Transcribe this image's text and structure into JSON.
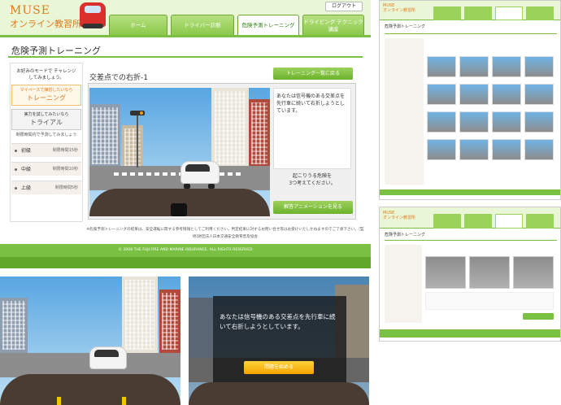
{
  "header": {
    "logo_line1": "MUSE",
    "logo_line2": "オンライン教習所",
    "logout": "ログアウト",
    "tabs": [
      "ホーム",
      "ドライバー診断",
      "危険予測トレーニング",
      "ドライビング テクニック講座"
    ],
    "active_tab": 2
  },
  "page": {
    "title": "危険予測トレーニング"
  },
  "sidebar": {
    "message": "お好みのモードで チャレンジしてみましょう。",
    "mode1_small": "マイペースで練習したいなら",
    "mode1_big": "トレーニング",
    "mode2_small": "実力を試してみたいなら",
    "mode2_big": "トライアル",
    "time_note": "制限時間内で予測してみましょう",
    "levels": [
      {
        "name": "初級",
        "time": "制限時間15秒"
      },
      {
        "name": "中級",
        "time": "制限時間10秒"
      },
      {
        "name": "上級",
        "time": "制限時間5秒"
      }
    ]
  },
  "main": {
    "scenario_title": "交差点での右折-1",
    "list_button": "トレーニング一覧に戻る",
    "question": "あなたは信号機のある交差点を先行車に続いて右折しようとしています。",
    "think_line1": "起こりうる危険を",
    "think_line2": "3つ考えてください。",
    "answer_button": "解答アニメーションを見る"
  },
  "note": "※危険予測トレーニングの結果は、安全運転に関する参考情報としてご利用ください。判定結果に対するお問い合せ等はお受けいたしかねますのでご了承下さい。［監修]財団法人日本交通安全教育普及協会",
  "footer": "© 2008 THE FUJI FIRE AND MARINE INSURANCE. ALL RIGHTS RESERVED",
  "overlay": {
    "text": "あなたは信号機のある交差点を先行車に続いて右折しようとしています。",
    "start_button": "問題を始める"
  },
  "colors": {
    "accent_green": "#7ac143",
    "logo_orange": "#e07a1a",
    "button_yellow": "#f3a400"
  }
}
